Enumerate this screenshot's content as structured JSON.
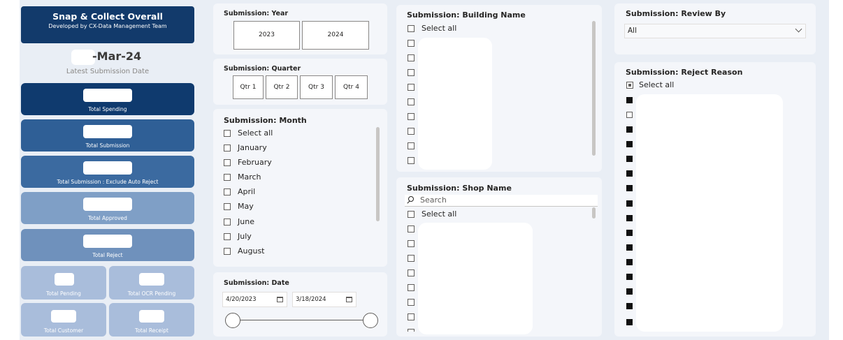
{
  "header": {
    "title": "Snap & Collect Overall",
    "subtitle": "Developed by CX-Data Management Team"
  },
  "latest_date": {
    "value": "-Mar-24",
    "caption": "Latest Submission Date"
  },
  "kpis": {
    "total_spending": "Total Spending",
    "total_submission": "Total Submission",
    "total_submission_excl": "Total Submission : Exclude Auto Reject",
    "total_approved": "Total Approved",
    "total_reject": "Total Reject",
    "total_pending": "Total Pending",
    "total_ocr_pending": "Total OCR Pending",
    "total_customer": "Total Customer",
    "total_receipt": "Total Receipt"
  },
  "year_slicer": {
    "title": "Submission: Year",
    "options": [
      "2023",
      "2024"
    ]
  },
  "quarter_slicer": {
    "title": "Submission: Quarter",
    "options": [
      "Qtr 1",
      "Qtr 2",
      "Qtr 3",
      "Qtr 4"
    ]
  },
  "month_slicer": {
    "title": "Submission: Month",
    "items": [
      "Select all",
      "January",
      "February",
      "March",
      "April",
      "May",
      "June",
      "July",
      "August"
    ]
  },
  "date_slicer": {
    "title": "Submission: Date",
    "start": "4/20/2023",
    "end": "3/18/2024"
  },
  "building_slicer": {
    "title": "Submission: Building Name",
    "select_all": "Select all"
  },
  "shop_slicer": {
    "title": "Submission: Shop Name",
    "search_placeholder": "Search",
    "select_all": "Select all"
  },
  "review_slicer": {
    "title": "Submission: Review By",
    "selected": "All"
  },
  "reject_slicer": {
    "title": "Submission: Reject Reason",
    "select_all": "Select all"
  },
  "colors": {
    "navy": "#123a6b",
    "tile_dark": "#0f3a6e",
    "tile_mid": "#2f5f96",
    "tile_light": "#7f9fc6",
    "tile_pale": "#a9bddb"
  }
}
